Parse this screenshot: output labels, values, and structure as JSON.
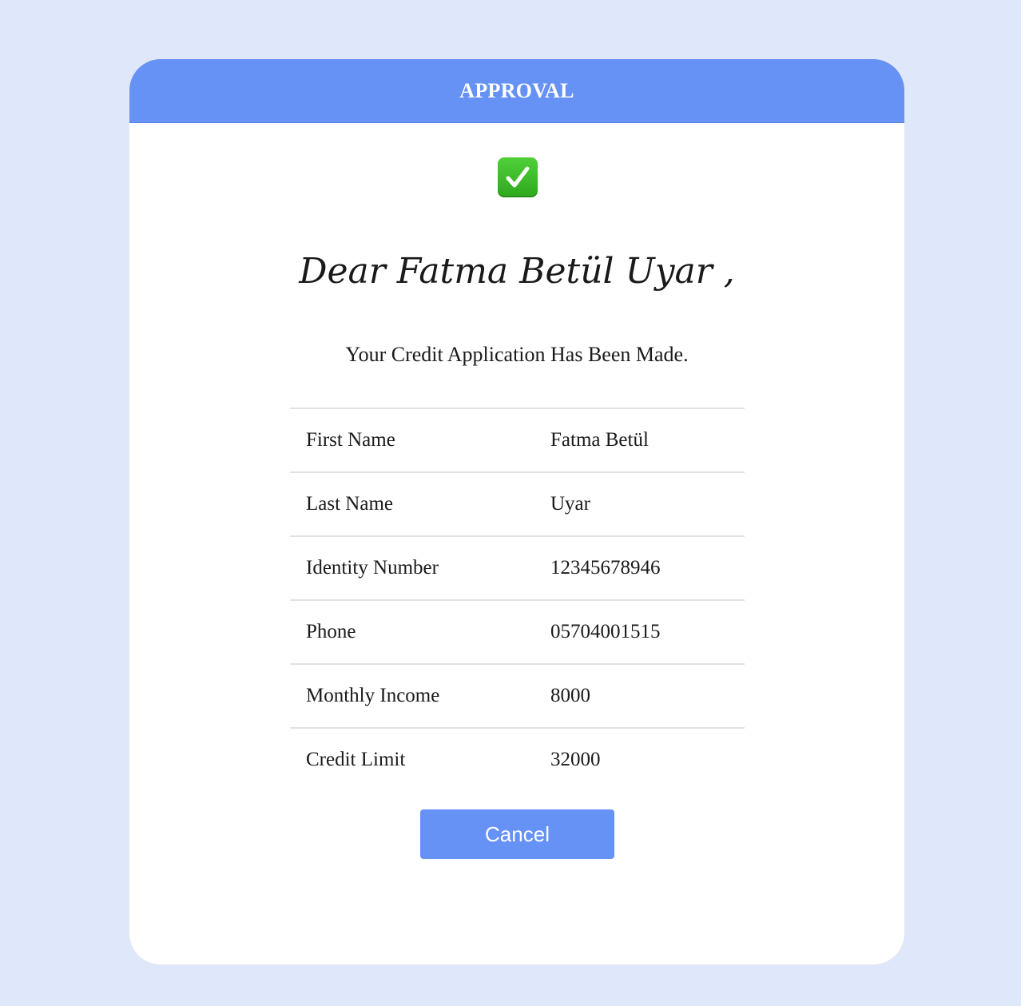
{
  "header": {
    "title": "APPROVAL"
  },
  "status_icon": "check-mark-icon",
  "greeting": "Dear Fatma Betül Uyar ,",
  "message": "Your Credit Application Has Been Made.",
  "details": [
    {
      "label": "First Name",
      "value": "Fatma Betül"
    },
    {
      "label": "Last Name",
      "value": "Uyar"
    },
    {
      "label": "Identity Number",
      "value": "12345678946"
    },
    {
      "label": "Phone",
      "value": "05704001515"
    },
    {
      "label": "Monthly Income",
      "value": "8000"
    },
    {
      "label": "Credit Limit",
      "value": "32000"
    }
  ],
  "actions": {
    "cancel_label": "Cancel"
  },
  "colors": {
    "page_background": "#dfe7fb",
    "accent": "#6691f5",
    "check_green": "#3cb82a"
  }
}
